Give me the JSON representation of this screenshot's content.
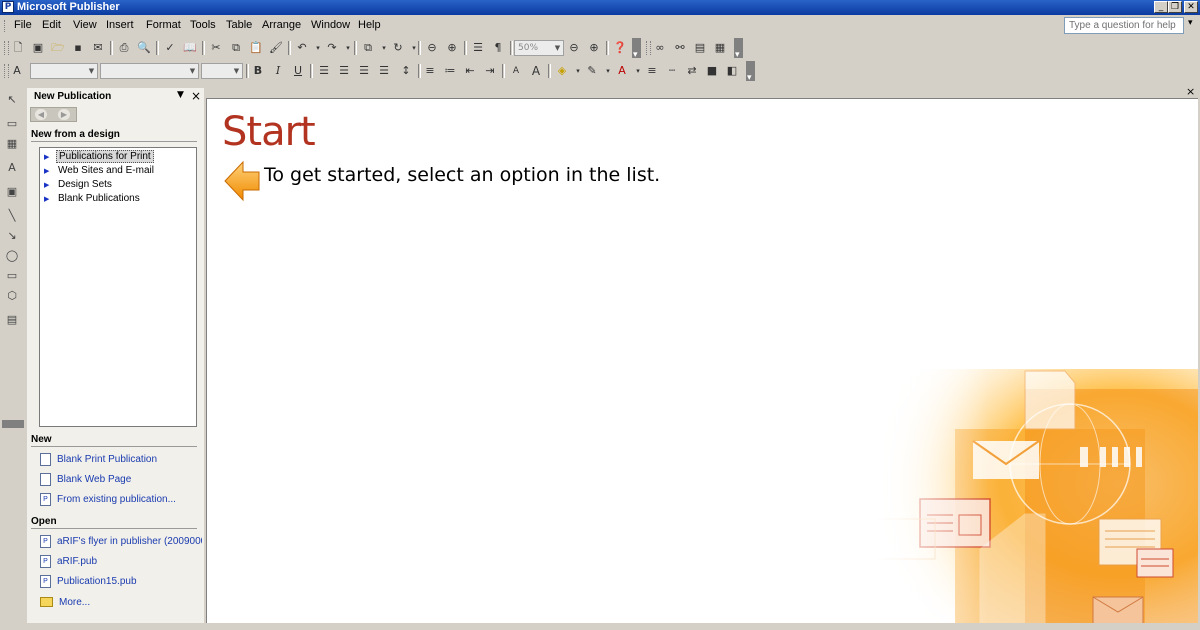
{
  "window": {
    "title": "Microsoft Publisher",
    "help_placeholder": "Type a question for help"
  },
  "menu": {
    "items": [
      {
        "label": "File"
      },
      {
        "label": "Edit"
      },
      {
        "label": "View"
      },
      {
        "label": "Insert"
      },
      {
        "label": "Format"
      },
      {
        "label": "Tools"
      },
      {
        "label": "Table"
      },
      {
        "label": "Arrange"
      },
      {
        "label": "Window"
      },
      {
        "label": "Help"
      }
    ]
  },
  "toolbar": {
    "zoom_value": "50%"
  },
  "task_pane": {
    "title": "New Publication",
    "section_design": "New from a design",
    "design_items": [
      {
        "label": "Publications for Print"
      },
      {
        "label": "Web Sites and E-mail"
      },
      {
        "label": "Design Sets"
      },
      {
        "label": "Blank Publications"
      }
    ],
    "section_new": "New",
    "new_items": [
      {
        "label": "Blank Print Publication"
      },
      {
        "label": "Blank Web Page"
      },
      {
        "label": "From existing publication..."
      }
    ],
    "section_open": "Open",
    "open_items": [
      {
        "label": "aRIF's flyer in publisher (20090000"
      },
      {
        "label": "aRIF.pub"
      },
      {
        "label": "Publication15.pub"
      },
      {
        "label": "More..."
      }
    ]
  },
  "document": {
    "heading": "Start",
    "instruction": "To get started, select an option in the list."
  },
  "colors": {
    "heading": "#b23320",
    "link": "#1a3bb0",
    "title_bar": "#0a3aa0"
  }
}
